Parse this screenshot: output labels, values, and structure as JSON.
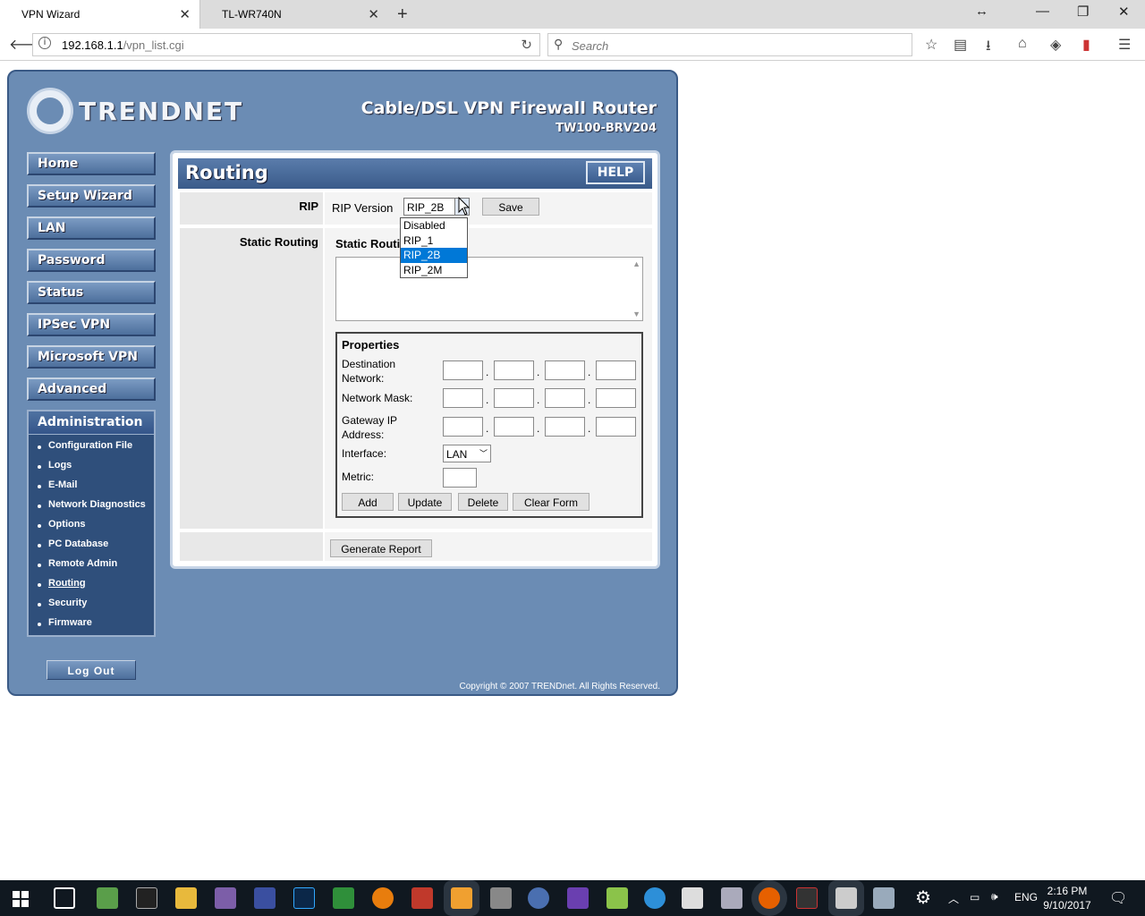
{
  "browser": {
    "tabs": [
      {
        "title": "VPN Wizard",
        "active": true
      },
      {
        "title": "TL-WR740N",
        "active": false
      }
    ],
    "new_tab": "+",
    "url_host": "192.168.1.1",
    "url_path": "/vpn_list.cgi",
    "search_placeholder": "Search",
    "window": {
      "resize": "↔",
      "minimize": "—",
      "restore": "❐",
      "close": "✕"
    }
  },
  "router": {
    "brand": "TRENDNET",
    "product_title": "Cable/DSL VPN Firewall Router",
    "product_model": "TW100-BRV204",
    "menu": [
      "Home",
      "Setup Wizard",
      "LAN",
      "Password",
      "Status",
      "IPSec VPN",
      "Microsoft VPN",
      "Advanced"
    ],
    "admin": {
      "title": "Administration",
      "items": [
        "Configuration File",
        "Logs",
        "E-Mail",
        "Network Diagnostics",
        "Options",
        "PC Database",
        "Remote Admin",
        "Routing",
        "Security",
        "Firmware"
      ],
      "current": "Routing"
    },
    "logout": "Log Out",
    "copyright": "Copyright © 2007 TRENDnet. All Rights Reserved."
  },
  "page": {
    "title": "Routing",
    "help": "HELP",
    "rip_row_label": "RIP",
    "rip_version_label": "RIP Version",
    "rip_selected": "RIP_2B",
    "rip_options": [
      "Disabled",
      "RIP_1",
      "RIP_2B",
      "RIP_2M"
    ],
    "save": "Save",
    "static_row_label": "Static Routing",
    "static_title": "Static Routing Entries",
    "properties": {
      "title": "Properties",
      "dest_label": "Destination Network:",
      "mask_label": "Network Mask:",
      "gateway_label": "Gateway IP Address:",
      "interface_label": "Interface:",
      "interface_value": "LAN",
      "metric_label": "Metric:",
      "buttons": {
        "add": "Add",
        "update": "Update",
        "delete": "Delete",
        "clear": "Clear Form"
      }
    },
    "generate_report": "Generate Report"
  },
  "taskbar": {
    "lang": "ENG",
    "time": "2:16 PM",
    "date": "9/10/2017"
  }
}
